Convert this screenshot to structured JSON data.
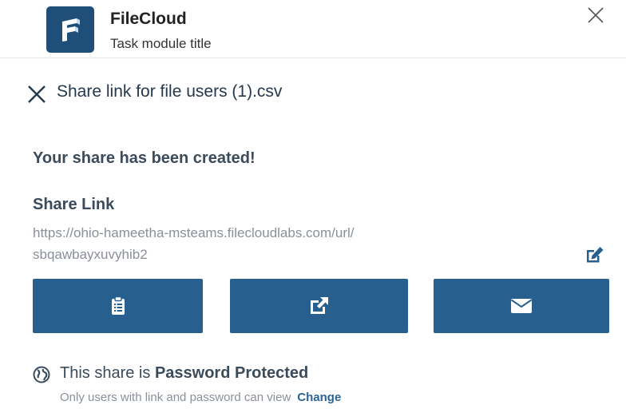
{
  "app": {
    "name": "FileCloud",
    "subtitle": "Task module title"
  },
  "share": {
    "title": "Share link for file users (1).csv",
    "success_message": "Your share has been created!",
    "link_label": "Share Link",
    "link_url_line1": "https://ohio-hameetha-msteams.filecloudlabs.com/url/",
    "link_url_line2": "sbqawbayxuvyhib2"
  },
  "actions": [
    {
      "name": "copy",
      "icon": "clipboard-icon"
    },
    {
      "name": "open",
      "icon": "external-link-icon"
    },
    {
      "name": "email",
      "icon": "envelope-icon"
    }
  ],
  "protection": {
    "prefix": "This share is ",
    "status": "Password Protected",
    "note": "Only users with link and password can view",
    "change_label": "Change"
  },
  "colors": {
    "brand": "#1f4e79",
    "button": "#27608f",
    "link": "#2a6496",
    "muted_text": "#8a9099"
  }
}
